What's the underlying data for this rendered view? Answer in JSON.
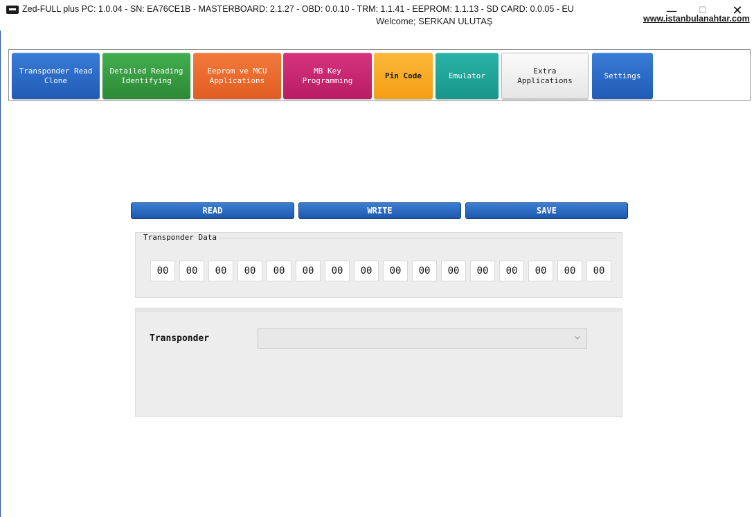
{
  "window": {
    "title": "Zed-FULL plus PC: 1.0.04 - SN: EA76CE1B - MASTERBOARD: 2.1.27 - OBD: 0.0.10 - TRM: 1.1.41 - EEPROM: 1.1.13 - SD CARD: 0.0.05 - EU",
    "minimize": "—",
    "maximize": "☐",
    "close": "✕"
  },
  "header": {
    "welcome": "Welcome; SERKAN ULUTAŞ",
    "website": "www.istanbulanahtar.com"
  },
  "menu": [
    {
      "line1": "Transponder Read",
      "line2": "Clone"
    },
    {
      "line1": "Detailed Reading",
      "line2": "Identifying"
    },
    {
      "line1": "Eeprom ve MCU",
      "line2": "Applications"
    },
    {
      "line1": "MB Key",
      "line2": "Programming"
    },
    {
      "line1": "Pin Code",
      "line2": ""
    },
    {
      "line1": "Emulator",
      "line2": ""
    },
    {
      "line1": "Extra",
      "line2": "Applications"
    },
    {
      "line1": "Settings",
      "line2": ""
    }
  ],
  "actions": {
    "read": "READ",
    "write": "WRITE",
    "save": "SAVE"
  },
  "transponder_data": {
    "title": "Transponder Data",
    "bytes": [
      "00",
      "00",
      "00",
      "00",
      "00",
      "00",
      "00",
      "00",
      "00",
      "00",
      "00",
      "00",
      "00",
      "00",
      "00",
      "00"
    ]
  },
  "transponder_select": {
    "label": "Transponder",
    "value": ""
  },
  "colors": {
    "blue": "#1f5bb5",
    "green": "#2c8a36",
    "orange": "#e25d21",
    "magenta": "#b81c63",
    "yellow": "#f49e14",
    "teal": "#17968a"
  }
}
